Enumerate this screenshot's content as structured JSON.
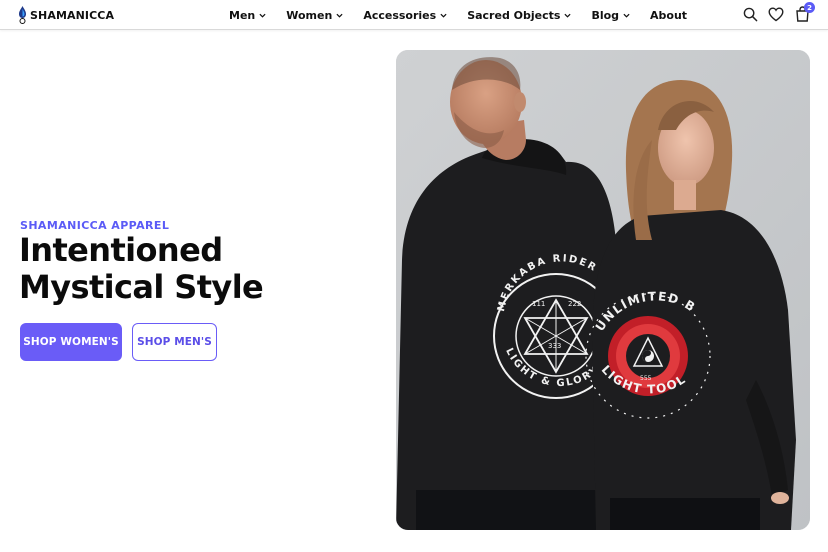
{
  "brand": {
    "name": "SHAMANICCA",
    "logo_icon": "feather-droplet-icon"
  },
  "nav": {
    "items": [
      {
        "label": "Men",
        "has_dropdown": true
      },
      {
        "label": "Women",
        "has_dropdown": true
      },
      {
        "label": "Accessories",
        "has_dropdown": true
      },
      {
        "label": "Sacred Objects",
        "has_dropdown": true
      },
      {
        "label": "Blog",
        "has_dropdown": true
      },
      {
        "label": "About",
        "has_dropdown": false
      }
    ]
  },
  "header_icons": {
    "search": "search-icon",
    "wishlist": "heart-icon",
    "cart": "cart-icon",
    "cart_count": "2"
  },
  "hero": {
    "eyebrow": "SHAMANICCA APPAREL",
    "headline_line1": "Intentioned",
    "headline_line2": "Mystical Style",
    "primary_button": "SHOP WOMEN'S",
    "secondary_button": "SHOP MEN'S",
    "image": {
      "description_icon": "hero-photo",
      "left_hoodie_print": {
        "top_text": "MERKABA RIDER",
        "bottom_text": "LIGHT & GLORY",
        "numbers": [
          "111",
          "222",
          "333"
        ]
      },
      "right_hoodie_print": {
        "top_text": "UNLIMITED BEING",
        "bottom_text": "LIGHT TOOL",
        "number": "555"
      }
    }
  },
  "colors": {
    "accent": "#6a5cf7",
    "text": "#0b0b0b",
    "background": "#ffffff"
  }
}
